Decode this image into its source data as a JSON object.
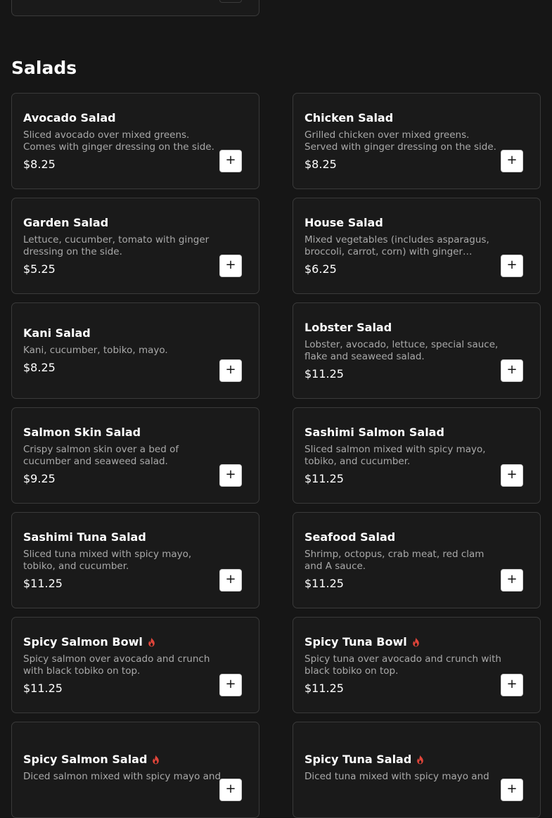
{
  "section": {
    "title": "Salads"
  },
  "add_label": "+",
  "colors": {
    "background": "#161616",
    "card": "#1a1a1a",
    "border": "#3a3a3a",
    "spicy": "#e0453a",
    "description": "#a9a9a9"
  },
  "items": [
    {
      "name": "Avocado Salad",
      "description": "Sliced avocado over mixed greens. Comes with ginger dressing on the side.",
      "price": "$8.25",
      "spicy": false
    },
    {
      "name": "Chicken Salad",
      "description": "Grilled chicken over mixed greens. Served with ginger dressing on the side.",
      "price": "$8.25",
      "spicy": false
    },
    {
      "name": "Garden Salad",
      "description": "Lettuce, cucumber, tomato with ginger dressing on the side.",
      "price": "$5.25",
      "spicy": false
    },
    {
      "name": "House Salad",
      "description": "Mixed vegetables (includes asparagus, broccoli, carrot, corn) with ginger dressing",
      "price": "$6.25",
      "spicy": false
    },
    {
      "name": "Kani Salad",
      "description": "Kani, cucumber, tobiko, mayo.",
      "price": "$8.25",
      "spicy": false
    },
    {
      "name": "Lobster Salad",
      "description": "Lobster, avocado, lettuce, special sauce, flake and seaweed salad.",
      "price": "$11.25",
      "spicy": false
    },
    {
      "name": "Salmon Skin Salad",
      "description": "Crispy salmon skin over a bed of cucumber and seaweed salad.",
      "price": "$9.25",
      "spicy": false
    },
    {
      "name": "Sashimi Salmon Salad",
      "description": "Sliced salmon mixed with spicy mayo, tobiko, and cucumber.",
      "price": "$11.25",
      "spicy": false
    },
    {
      "name": "Sashimi Tuna Salad",
      "description": "Sliced tuna mixed with spicy mayo, tobiko, and cucumber.",
      "price": "$11.25",
      "spicy": false
    },
    {
      "name": "Seafood Salad",
      "description": "Shrimp, octopus, crab meat, red clam and A sauce.",
      "price": "$11.25",
      "spicy": false
    },
    {
      "name": "Spicy Salmon Bowl",
      "description": "Spicy salmon over avocado and crunch with black tobiko on top.",
      "price": "$11.25",
      "spicy": true
    },
    {
      "name": "Spicy Tuna Bowl",
      "description": "Spicy tuna over avocado and crunch with black tobiko on top.",
      "price": "$11.25",
      "spicy": true
    },
    {
      "name": "Spicy Salmon Salad",
      "description": "Diced salmon mixed with spicy mayo and",
      "price": "",
      "spicy": true
    },
    {
      "name": "Spicy Tuna Salad",
      "description": "Diced tuna mixed with spicy mayo and",
      "price": "",
      "spicy": true
    }
  ]
}
